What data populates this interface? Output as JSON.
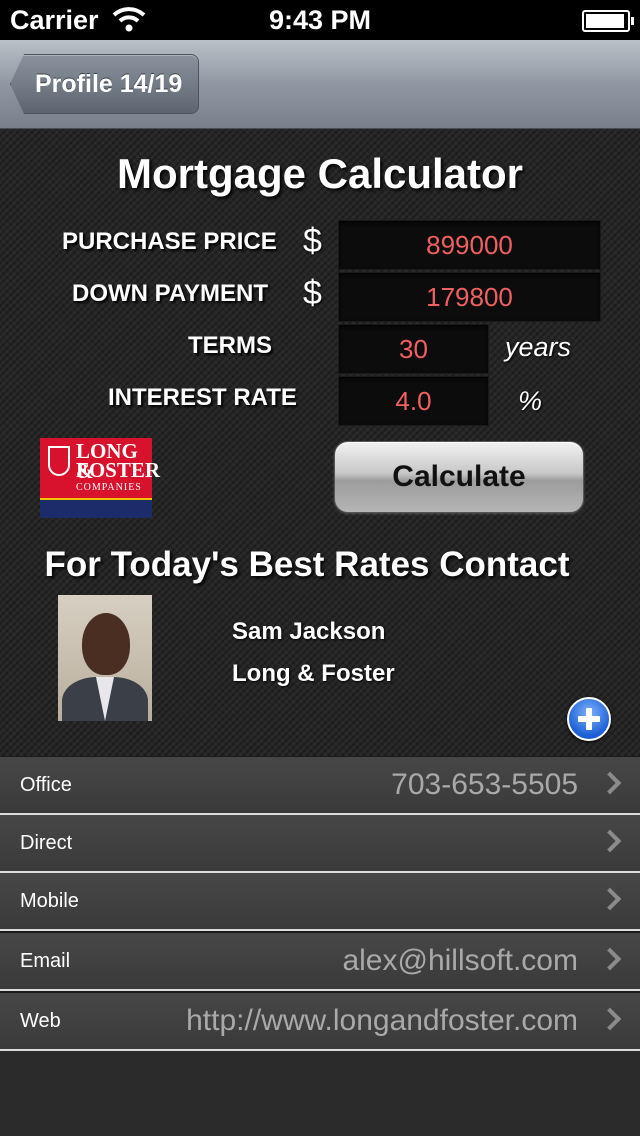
{
  "status_bar": {
    "carrier": "Carrier",
    "time": "9:43 PM"
  },
  "nav": {
    "back_label": "Profile 14/19"
  },
  "calculator": {
    "title": "Mortgage Calculator",
    "purchase_price": {
      "label": "PURCHASE PRICE",
      "currency": "$",
      "value": "899000"
    },
    "down_payment": {
      "label": "DOWN PAYMENT",
      "currency": "$",
      "value": "179800"
    },
    "terms": {
      "label": "TERMS",
      "value": "30",
      "unit": "years"
    },
    "interest_rate": {
      "label": "INTEREST RATE",
      "value": "4.0",
      "unit": "%"
    },
    "calculate_label": "Calculate"
  },
  "logo": {
    "line1": "LONG &",
    "line2": "FOSTER",
    "line3": "COMPANIES"
  },
  "contact": {
    "heading": "For Today's Best Rates Contact",
    "name": "Sam Jackson",
    "company": "Long & Foster"
  },
  "details": [
    {
      "label": "Office",
      "value": "703-653-5505"
    },
    {
      "label": "Direct",
      "value": ""
    },
    {
      "label": "Mobile",
      "value": ""
    },
    {
      "label": "Email",
      "value": "alex@hillsoft.com"
    },
    {
      "label": "Web",
      "value": "http://www.longandfoster.com"
    }
  ],
  "colors": {
    "input_text": "#f06060",
    "accent_blue": "#1c5fd6",
    "background": "#262626"
  }
}
